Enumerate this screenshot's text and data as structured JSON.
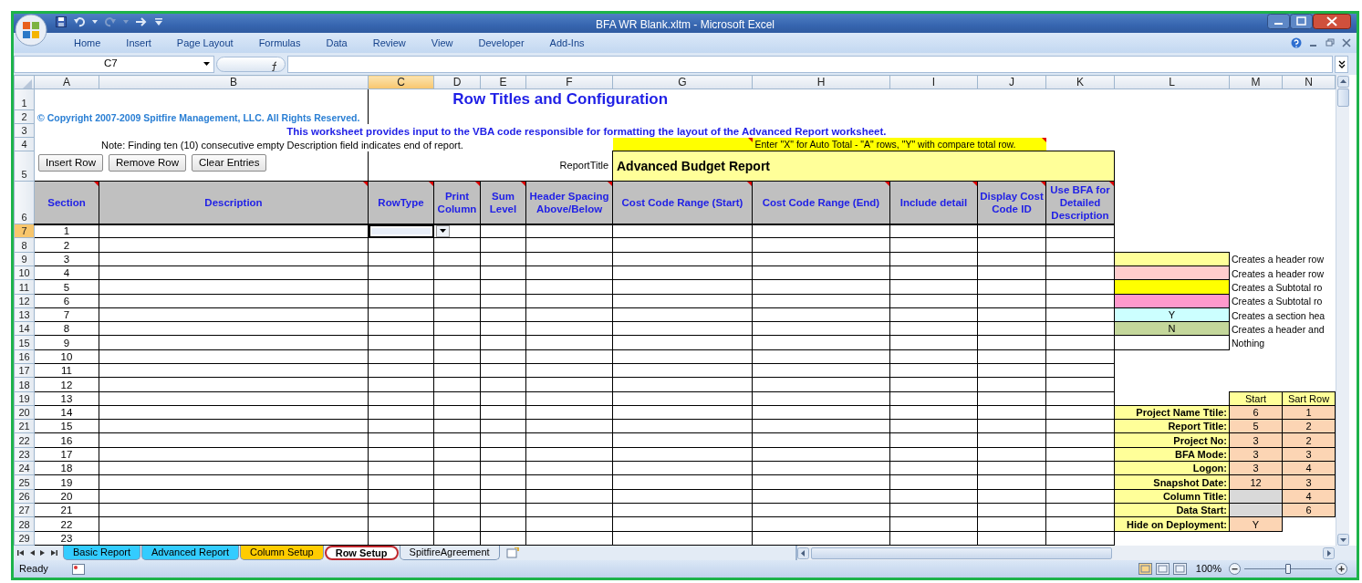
{
  "window": {
    "title": "BFA WR Blank.xltm - Microsoft Excel"
  },
  "ribbon_tabs": [
    "Home",
    "Insert",
    "Page Layout",
    "Formulas",
    "Data",
    "Review",
    "View",
    "Developer",
    "Add-Ins"
  ],
  "formula_bar": {
    "name_box": "C7"
  },
  "columns": [
    {
      "label": "A",
      "selected": false
    },
    {
      "label": "B",
      "selected": false
    },
    {
      "label": "C",
      "selected": true
    },
    {
      "label": "D",
      "selected": false
    },
    {
      "label": "E",
      "selected": false
    },
    {
      "label": "F",
      "selected": false
    },
    {
      "label": "G",
      "selected": false
    },
    {
      "label": "H",
      "selected": false
    },
    {
      "label": "I",
      "selected": false
    },
    {
      "label": "J",
      "selected": false
    },
    {
      "label": "K",
      "selected": false
    },
    {
      "label": "L",
      "selected": false
    },
    {
      "label": "M",
      "selected": false
    },
    {
      "label": "N",
      "selected": false
    }
  ],
  "row_numbers": [
    {
      "label": "1",
      "selected": false
    },
    {
      "label": "2",
      "selected": false
    },
    {
      "label": "3",
      "selected": false
    },
    {
      "label": "4",
      "selected": false
    },
    {
      "label": "5",
      "selected": false
    },
    {
      "label": "6",
      "selected": false
    },
    {
      "label": "7",
      "selected": true
    },
    {
      "label": "8",
      "selected": false
    },
    {
      "label": "9",
      "selected": false
    },
    {
      "label": "10",
      "selected": false
    },
    {
      "label": "11",
      "selected": false
    },
    {
      "label": "12",
      "selected": false
    },
    {
      "label": "13",
      "selected": false
    },
    {
      "label": "14",
      "selected": false
    },
    {
      "label": "15",
      "selected": false
    },
    {
      "label": "16",
      "selected": false
    },
    {
      "label": "17",
      "selected": false
    },
    {
      "label": "18",
      "selected": false
    },
    {
      "label": "19",
      "selected": false
    },
    {
      "label": "20",
      "selected": false
    },
    {
      "label": "21",
      "selected": false
    },
    {
      "label": "22",
      "selected": false
    },
    {
      "label": "23",
      "selected": false
    },
    {
      "label": "24",
      "selected": false
    },
    {
      "label": "25",
      "selected": false
    },
    {
      "label": "26",
      "selected": false
    },
    {
      "label": "27",
      "selected": false
    },
    {
      "label": "28",
      "selected": false
    },
    {
      "label": "29",
      "selected": false
    }
  ],
  "sheet": {
    "title": "Row Titles and Configuration",
    "copyright": "© Copyright 2007-2009 Spitfire Management, LLC. All Rights Reserved.",
    "description": "This worksheet provides input to the VBA code responsible for formatting the layout of the Advanced Report worksheet.",
    "note": "Note: Finding ten (10) consecutive empty Description field indicates end of report.",
    "auto_total_hint": "Enter \"X\" for Auto Total - \"A\" rows,  \"Y\" with compare total row.",
    "hint_has_comment": true,
    "report_title_label": "ReportTitle",
    "report_title": "Advanced Budget Report"
  },
  "buttons": [
    "Insert Row",
    "Remove Row",
    "Clear Entries"
  ],
  "table": {
    "columns": [
      {
        "label": "Section",
        "has_comment": true
      },
      {
        "label": "Description",
        "has_comment": true
      },
      {
        "label": "RowType",
        "has_comment": true
      },
      {
        "label": "Print Column",
        "has_comment": true
      },
      {
        "label": "Sum Level",
        "has_comment": true
      },
      {
        "label": "Header Spacing Above/Below",
        "has_comment": true
      },
      {
        "label": "Cost Code Range (Start)",
        "has_comment": true
      },
      {
        "label": "Cost Code Range (End)",
        "has_comment": true
      },
      {
        "label": "Include detail",
        "has_comment": true
      },
      {
        "label": "Display Cost Code ID",
        "has_comment": true
      },
      {
        "label": "Use BFA for Detailed Description",
        "has_comment": true
      }
    ],
    "rows": [
      {
        "section": "1",
        "selected": true
      },
      {
        "section": "2",
        "selected": false
      },
      {
        "section": "3",
        "selected": false
      },
      {
        "section": "4",
        "selected": false
      },
      {
        "section": "5",
        "selected": false
      },
      {
        "section": "6",
        "selected": false
      },
      {
        "section": "7",
        "selected": false
      },
      {
        "section": "8",
        "selected": false
      },
      {
        "section": "9",
        "selected": false
      },
      {
        "section": "10",
        "selected": false
      },
      {
        "section": "11",
        "selected": false
      },
      {
        "section": "12",
        "selected": false
      },
      {
        "section": "13",
        "selected": false
      },
      {
        "section": "14",
        "selected": false
      },
      {
        "section": "15",
        "selected": false
      },
      {
        "section": "16",
        "selected": false
      },
      {
        "section": "17",
        "selected": false
      },
      {
        "section": "18",
        "selected": false
      },
      {
        "section": "19",
        "selected": false
      },
      {
        "section": "20",
        "selected": false
      },
      {
        "section": "21",
        "selected": false
      },
      {
        "section": "22",
        "selected": false
      },
      {
        "section": "23",
        "selected": false
      }
    ]
  },
  "legend": [
    {
      "color": "#ffff99",
      "description": "Creates a header row"
    },
    {
      "color": "#ffcccc",
      "description": "Creates a header row"
    },
    {
      "color": "#ffff00",
      "description": "Creates a Subtotal ro"
    },
    {
      "color": "#ff99cc",
      "description": "Creates a Subtotal ro"
    },
    {
      "color": "#ccffff",
      "value": "Y",
      "description": "Creates a section hea"
    },
    {
      "color": "#c4d79b",
      "value": "N",
      "description": "Creates a header and"
    },
    {
      "color": "#ffffff",
      "description": "Nothing"
    }
  ],
  "positions": {
    "columns": [
      "Start",
      "Sart Row"
    ],
    "rows": [
      {
        "label": "Project Name Ttile:",
        "start": "6",
        "start_row": "1"
      },
      {
        "label": "Report Title:",
        "start": "5",
        "start_row": "2"
      },
      {
        "label": "Project No:",
        "start": "3",
        "start_row": "2"
      },
      {
        "label": "BFA Mode:",
        "start": "3",
        "start_row": "3"
      },
      {
        "label": "Logon:",
        "start": "3",
        "start_row": "4"
      },
      {
        "label": "Snapshot Date:",
        "start": "12",
        "start_row": "3"
      },
      {
        "label": "Column Title:",
        "start_row": "4"
      },
      {
        "label": "Data Start:",
        "start_row": "6"
      },
      {
        "label": "Hide on Deployment:",
        "start": "Y"
      }
    ]
  },
  "sheet_tabs": [
    {
      "label": "Basic Report",
      "selected": false,
      "highlighted": false,
      "color": "#33ccff"
    },
    {
      "label": "Advanced Report",
      "selected": false,
      "highlighted": false,
      "color": "#33ccff"
    },
    {
      "label": "Column Setup",
      "selected": false,
      "highlighted": false,
      "color": "#ffcc00"
    },
    {
      "label": "Row Setup",
      "selected": true,
      "highlighted": true
    },
    {
      "label": "SpitfireAgreement",
      "selected": false,
      "highlighted": false
    }
  ],
  "status_bar": {
    "status": "Ready",
    "zoom": "100%",
    "zoom_slider": {
      "level": 0.5
    }
  }
}
